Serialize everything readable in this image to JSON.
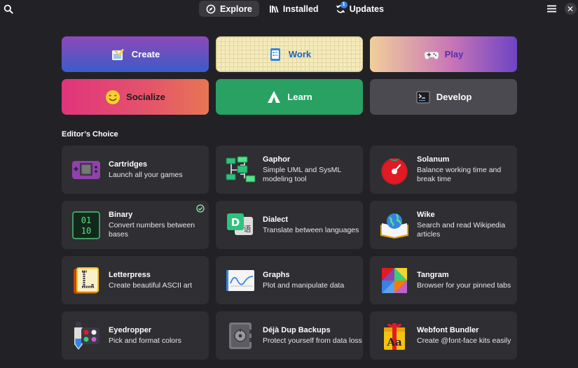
{
  "header": {
    "tabs": [
      {
        "label": "Explore",
        "icon": "compass-icon",
        "active": true
      },
      {
        "label": "Installed",
        "icon": "library-icon",
        "active": false
      },
      {
        "label": "Updates",
        "icon": "refresh-icon",
        "active": false,
        "badge": "1"
      }
    ]
  },
  "categories": [
    {
      "label": "Create",
      "icon": "create-icon"
    },
    {
      "label": "Work",
      "icon": "work-icon"
    },
    {
      "label": "Play",
      "icon": "gamepad-icon"
    },
    {
      "label": "Socialize",
      "icon": "emoji-icon"
    },
    {
      "label": "Learn",
      "icon": "tent-icon"
    },
    {
      "label": "Develop",
      "icon": "terminal-icon"
    }
  ],
  "section": {
    "title": "Editor’s Choice"
  },
  "apps": [
    {
      "name": "Cartridges",
      "description": "Launch all your games",
      "icon": "cartridges-icon"
    },
    {
      "name": "Gaphor",
      "description": "Simple UML and SysML modeling tool",
      "icon": "gaphor-icon"
    },
    {
      "name": "Solanum",
      "description": "Balance working time and break time",
      "icon": "solanum-icon"
    },
    {
      "name": "Binary",
      "description": "Convert numbers between bases",
      "icon": "binary-icon",
      "installed": true
    },
    {
      "name": "Dialect",
      "description": "Translate between languages",
      "icon": "dialect-icon"
    },
    {
      "name": "Wike",
      "description": "Search and read Wikipedia articles",
      "icon": "wike-icon"
    },
    {
      "name": "Letterpress",
      "description": "Create beautiful ASCII art",
      "icon": "letterpress-icon"
    },
    {
      "name": "Graphs",
      "description": "Plot and manipulate data",
      "icon": "graphs-icon"
    },
    {
      "name": "Tangram",
      "description": "Browser for your pinned tabs",
      "icon": "tangram-icon"
    },
    {
      "name": "Eyedropper",
      "description": "Pick and format colors",
      "icon": "eyedropper-icon"
    },
    {
      "name": "Déjà Dup Backups",
      "description": "Protect yourself from data loss",
      "icon": "deja-dup-icon"
    },
    {
      "name": "Webfont Bundler",
      "description": "Create @font-face kits easily",
      "icon": "webfont-bundler-icon"
    }
  ],
  "colors": {
    "background": "#222226",
    "card": "#2e2e33",
    "accent": "#3584e4"
  }
}
